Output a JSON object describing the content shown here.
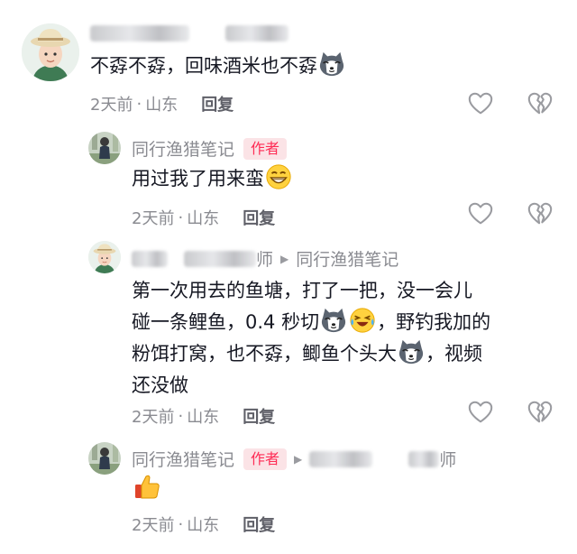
{
  "comments": [
    {
      "author_suffix": "",
      "text": "不孬不孬，回味酒米也不孬",
      "time": "2天前",
      "location": "山东",
      "reply": "回复"
    },
    {
      "author": "同行渔猎笔记",
      "badge": "作者",
      "text": "用过我了用来蛮",
      "time": "2天前",
      "location": "山东",
      "reply": "回复"
    },
    {
      "author_suffix": "师",
      "reply_to": "同行渔猎笔记",
      "lines": [
        "第一次用去的鱼塘，打了一把，没一会儿",
        "碰一条鲤鱼，0.4 秒切",
        "，野钓我加的",
        "粉饵打窝，也不孬，鲫鱼个头大",
        "，视频",
        "还没做"
      ],
      "time": "2天前",
      "location": "山东",
      "reply": "回复"
    },
    {
      "author": "同行渔猎笔记",
      "badge": "作者",
      "reply_to_suffix": "师",
      "time": "2天前",
      "location": "山东",
      "reply": "回复"
    }
  ],
  "meta_separator": "·",
  "icons": {
    "like": "heart-outline-icon",
    "dislike": "broken-heart-icon",
    "reply_arrow": "right-triangle-icon",
    "emoji_husky": "husky-emoji-icon",
    "emoji_grin": "grin-emoji-icon",
    "emoji_laugh": "laugh-cry-emoji-icon",
    "emoji_thumb": "thumbs-up-emoji-icon"
  },
  "colors": {
    "author_badge_bg": "#fbe3e6",
    "author_badge_text": "#fe2c55",
    "meta_text": "#8a8b91",
    "body_text": "#161823"
  }
}
